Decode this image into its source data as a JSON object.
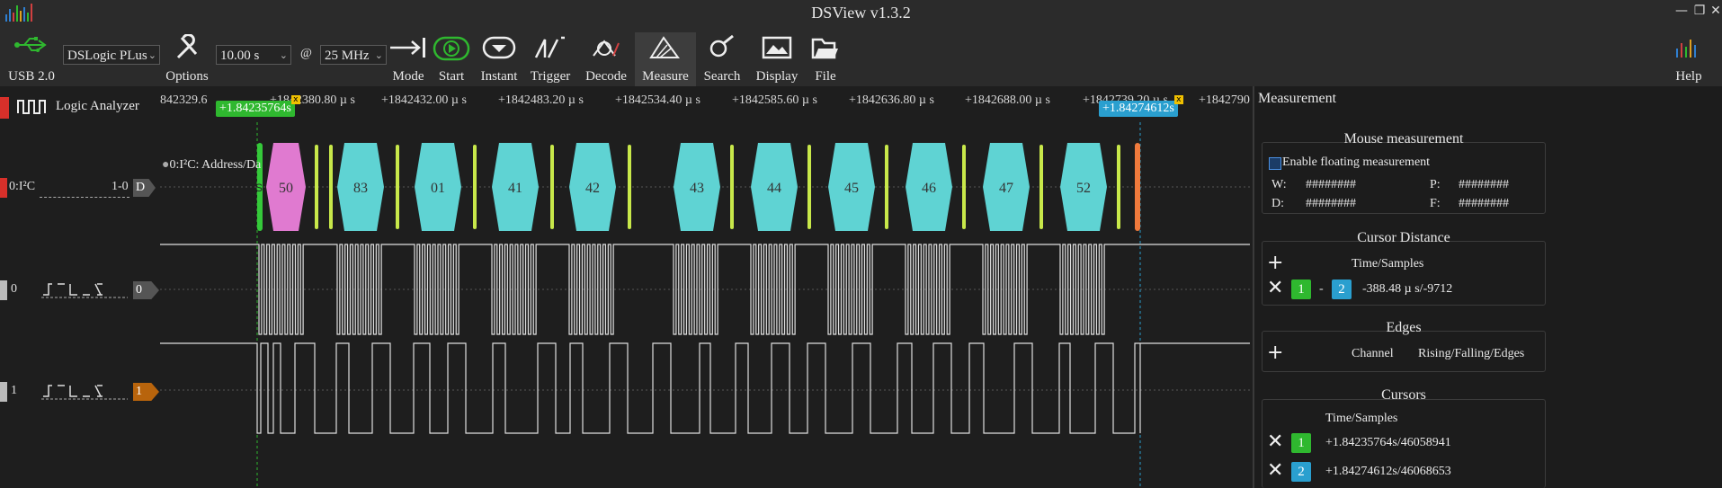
{
  "window": {
    "title": "DSView v1.3.2"
  },
  "toolbar": {
    "usb_label": "USB 2.0",
    "device": "DSLogic PLus",
    "options_label": "Options",
    "sample_time": "10.00 s",
    "at_symbol": "@",
    "sample_rate": "25 MHz",
    "mode_label": "Mode",
    "start_label": "Start",
    "instant_label": "Instant",
    "trigger_label": "Trigger",
    "decode_label": "Decode",
    "measure_label": "Measure",
    "search_label": "Search",
    "display_label": "Display",
    "file_label": "File",
    "help_label": "Help"
  },
  "timeline": {
    "title": "Logic Analyzer",
    "ticks": [
      "842329.6",
      "+1842380.80 µ s",
      "+1842432.00 µ s",
      "+1842483.20 µ s",
      "+1842534.40 µ s",
      "+1842585.60 µ s",
      "+1842636.80 µ s",
      "+1842688.00 µ s",
      "+1842739.20 µ s",
      "+1842790"
    ],
    "cursor1_label": "+1.84235764s",
    "cursor2_label": "+1.84274612s"
  },
  "channels": {
    "decoder": {
      "name": "0:I²C",
      "range": "1-0",
      "tag": "D",
      "annotation_title": "0:I²C: Address/Da",
      "start": "S",
      "stop": "P"
    },
    "ch0": {
      "name": "0",
      "tag": "0"
    },
    "ch1": {
      "name": "1",
      "tag": "1"
    }
  },
  "decoded_bytes": [
    "50",
    "83",
    "01",
    "41",
    "42",
    "43",
    "44",
    "45",
    "46",
    "47",
    "52"
  ],
  "colors": {
    "addr": "#e07ad0",
    "data": "#5fd3d3",
    "ack": "#c8e84a",
    "start": "#35c93a",
    "stop": "#f07a3c",
    "cursor1": "#2fb82f",
    "cursor2": "#2a9fcf",
    "ch1_tag": "#b8640c"
  },
  "measurement": {
    "title": "Measurement",
    "mouse": {
      "title": "Mouse measurement",
      "enable_label": "Enable floating measurement",
      "w_label": "W:",
      "w_value": "########",
      "p_label": "P:",
      "p_value": "########",
      "d_label": "D:",
      "d_value": "########",
      "f_label": "F:",
      "f_value": "########"
    },
    "cursor_distance": {
      "title": "Cursor Distance",
      "header": "Time/Samples",
      "c1": "1",
      "sep": "-",
      "c2": "2",
      "value": "-388.48 µ s/-9712"
    },
    "edges": {
      "title": "Edges",
      "channel_header": "Channel",
      "edges_header": "Rising/Falling/Edges"
    },
    "cursors": {
      "title": "Cursors",
      "header": "Time/Samples",
      "c1": "1",
      "c1_value": "+1.84235764s/46058941",
      "c2": "2",
      "c2_value": "+1.84274612s/46068653"
    }
  }
}
